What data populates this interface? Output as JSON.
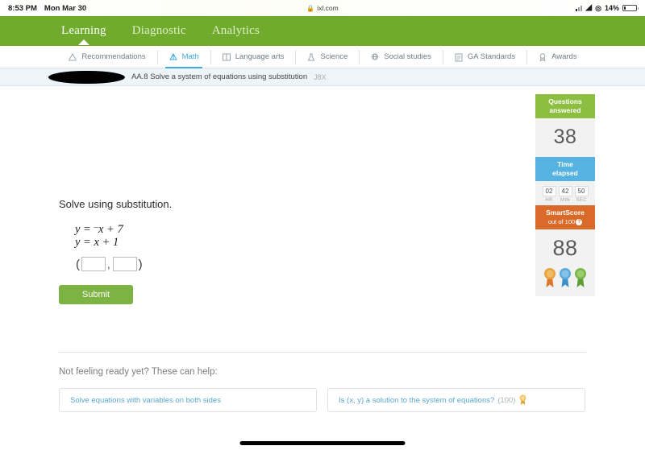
{
  "status_bar": {
    "time": "8:53 PM",
    "date": "Mon Mar 30",
    "url": "ixl.com",
    "lock_icon": "lock-icon",
    "battery_percent": "14%",
    "signal_icon": "cellular-signal-icon",
    "wifi_icon": "wifi-icon",
    "location_icon": "location-services-icon"
  },
  "top_nav": {
    "items": [
      {
        "label": "Learning",
        "active": true
      },
      {
        "label": "Diagnostic",
        "active": false
      },
      {
        "label": "Analytics",
        "active": false
      }
    ],
    "background_color": "#70ab2e"
  },
  "sub_nav": {
    "items": [
      {
        "label": "Recommendations",
        "icon": "recommendations-icon",
        "active": false
      },
      {
        "label": "Math",
        "icon": "math-icon",
        "active": true
      },
      {
        "label": "Language arts",
        "icon": "book-icon",
        "active": false
      },
      {
        "label": "Science",
        "icon": "flask-icon",
        "active": false
      },
      {
        "label": "Social studies",
        "icon": "globe-icon",
        "active": false
      },
      {
        "label": "GA Standards",
        "icon": "clipboard-icon",
        "active": false
      },
      {
        "label": "Awards",
        "icon": "awards-icon",
        "active": false
      }
    ],
    "active_color": "#3ba9dd"
  },
  "skill_bar": {
    "redacted_label": "",
    "skill_title": "AA.8 Solve a system of equations using substitution",
    "skill_code": "J8X"
  },
  "question": {
    "prompt": "Solve using substitution.",
    "equation_1_prefix": "y = ",
    "equation_1_minus": "–",
    "equation_1_rest": "x + 7",
    "equation_2": "y = x + 1",
    "answer_open_paren": "(",
    "answer_comma": ",",
    "answer_close_paren": ")",
    "answer_x_value": "",
    "answer_y_value": "",
    "answer_placeholder": "",
    "submit_label": "Submit"
  },
  "score_panel": {
    "questions_answered": {
      "title_line_1": "Questions",
      "title_line_2": "answered",
      "value": "38",
      "color": "#8cbf3f"
    },
    "time_elapsed": {
      "title_line_1": "Time",
      "title_line_2": "elapsed",
      "color": "#56b2e0",
      "hours": "02",
      "minutes": "42",
      "seconds": "50",
      "label_hr": "HR",
      "label_min": "MIN",
      "label_sec": "SEC"
    },
    "smartscore": {
      "title": "SmartScore",
      "subtitle": "out of 100",
      "help_icon": "question-mark-icon",
      "value": "88",
      "color": "#d96a29",
      "medals": [
        "#e8a33d",
        "#5aa9dd",
        "#7ab648"
      ]
    }
  },
  "helper": {
    "title": "Not feeling ready yet? These can help:",
    "cards": [
      {
        "label": "Solve equations with variables on both sides",
        "count": "",
        "medal": false
      },
      {
        "label": "Is (x, y) a solution to the system of equations?",
        "count": "(100)",
        "medal": true
      }
    ]
  }
}
